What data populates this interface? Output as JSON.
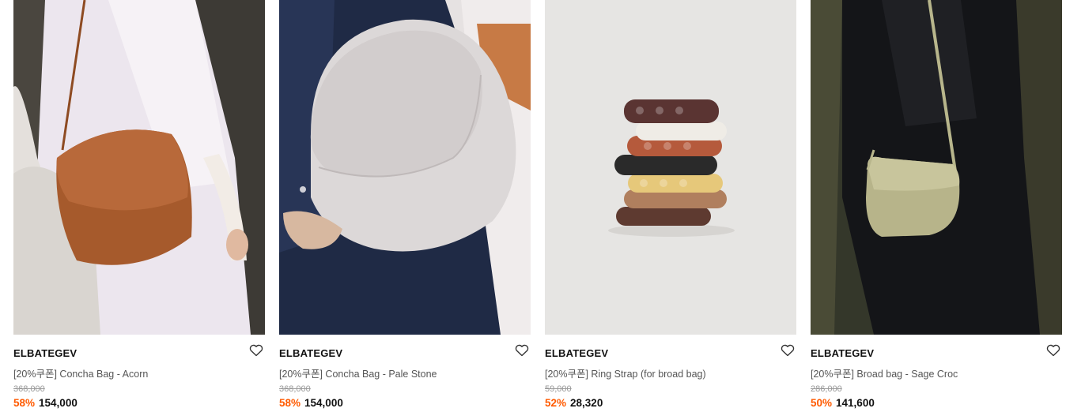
{
  "products": [
    {
      "brand": "ELBATEGEV",
      "name": "[20%쿠폰] Concha Bag - Acorn",
      "original_price": "368,000",
      "discount": "58%",
      "sale_price": "154,000",
      "image": "tan crossbody bag on model in white dress"
    },
    {
      "brand": "ELBATEGEV",
      "name": "[20%쿠폰] Concha Bag - Pale Stone",
      "original_price": "368,000",
      "discount": "58%",
      "sale_price": "154,000",
      "image": "pale grey crossbody bag on model in navy"
    },
    {
      "brand": "ELBATEGEV",
      "name": "[20%쿠폰] Ring Strap (for broad bag)",
      "original_price": "59,000",
      "discount": "52%",
      "sale_price": "28,320",
      "image": "stack of colored ring straps"
    },
    {
      "brand": "ELBATEGEV",
      "name": "[20%쿠폰] Broad bag - Sage Croc",
      "original_price": "286,000",
      "discount": "50%",
      "sale_price": "141,600",
      "image": "sage croc bag on model in black coat"
    }
  ],
  "icons": {
    "wishlist": "heart-outline-icon"
  },
  "colors": {
    "discount": "#ff5a00",
    "strikethrough": "#9a9a9a",
    "text": "#111111"
  }
}
